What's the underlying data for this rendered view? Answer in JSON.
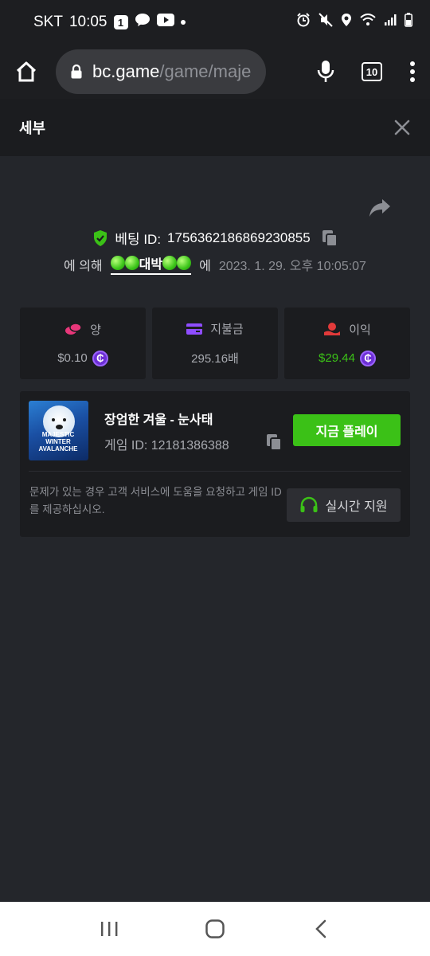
{
  "status_bar": {
    "carrier": "SKT",
    "time": "10:05",
    "notification_badge": "1"
  },
  "browser": {
    "url_host": "bc.game",
    "url_path": "/game/maje",
    "tab_count": "10"
  },
  "modal": {
    "title": "세부"
  },
  "bet": {
    "id_label": "베팅 ID:",
    "id_value": "1756362186869230855",
    "by_label": "에 의해",
    "user_name": "대박",
    "at_label": "에",
    "datetime": "2023. 1. 29. 오후 10:05:07"
  },
  "stats": [
    {
      "label": "양",
      "value": "$0.10",
      "icon": "coins-icon",
      "icon_color": "#e8377a",
      "has_coin": true,
      "value_color": "#a8aab0"
    },
    {
      "label": "지불금",
      "value": "295.16배",
      "icon": "card-icon",
      "icon_color": "#8f4dff",
      "has_coin": false,
      "value_color": "#a8aab0"
    },
    {
      "label": "이익",
      "value": "$29.44",
      "icon": "profit-hand-icon",
      "icon_color": "#e23a3a",
      "has_coin": true,
      "value_color": "#3bc117"
    }
  ],
  "coin_symbol": "₵",
  "game": {
    "name": "장엄한 겨울 - 눈사태",
    "id_text": "게임 ID: 12181386388",
    "thumb_text": "MAJESTIC WINTER AVALANCHE",
    "play_label": "지금 플레이",
    "help_text": "문제가 있는 경우 고객 서비스에 도움을 요청하고 게임 ID를 제공하십시오.",
    "support_label": "실시간 지원"
  },
  "colors": {
    "accent_green": "#3bc117",
    "panel_bg": "#1b1c1f",
    "page_bg": "#24262b"
  }
}
